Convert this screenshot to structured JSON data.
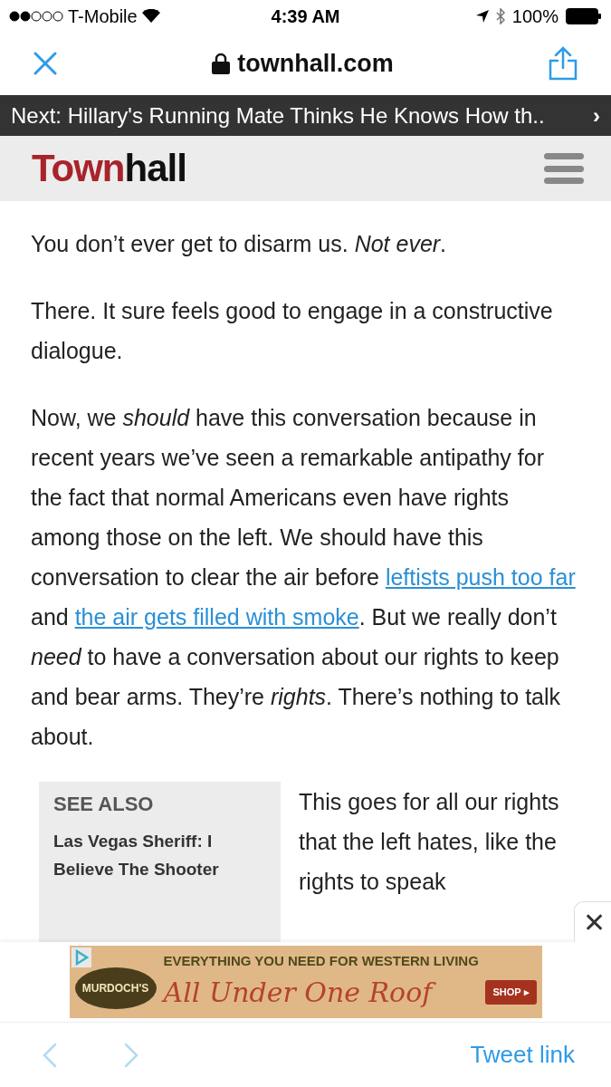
{
  "status_bar": {
    "carrier": "T-Mobile",
    "time": "4:39 AM",
    "battery": "100%"
  },
  "browser_bar": {
    "domain": "townhall.com"
  },
  "next_banner": {
    "text": "Next: Hillary's Running Mate Thinks He Knows How th..",
    "arrow": "›"
  },
  "site_header": {
    "logo_red": "Town",
    "logo_dark": "hall"
  },
  "article": {
    "paragraphs": [
      [
        {
          "kind": "text",
          "text": "You don’t ever get to disarm us. *Not ever*."
        }
      ],
      [
        {
          "kind": "text",
          "text": "There. It sure feels good to engage in a constructive dialogue."
        }
      ],
      [
        {
          "kind": "text",
          "text": "Now, we *should* have this conversation because in recent years we’ve seen a remarkable antipathy for the fact that normal Americans even have rights among those on the left. We should have this conversation to clear the air before "
        },
        {
          "kind": "link",
          "text": "leftists push too far"
        },
        {
          "kind": "text",
          "text": " and "
        },
        {
          "kind": "link",
          "text": "the air gets filled with smoke"
        },
        {
          "kind": "text",
          "text": ". But we really don’t *need* to have a conversation about our rights to keep and bear arms. They’re *rights*. There’s nothing to talk about."
        }
      ]
    ],
    "see_also": {
      "heading": "SEE ALSO",
      "title": "Las Vegas Sheriff: I Believe The Shooter"
    },
    "side_paragraph": "This goes for all our rights that the left hates, like the rights to speak"
  },
  "ad": {
    "close": "✕",
    "headline": "EVERYTHING YOU NEED FOR WESTERN LIVING",
    "slogan": "All Under One Roof",
    "brand": "MURDOCH'S",
    "button": "SHOP ▸"
  },
  "toolbar": {
    "back_disabled": true,
    "forward_disabled": true,
    "action": "Tweet link"
  }
}
